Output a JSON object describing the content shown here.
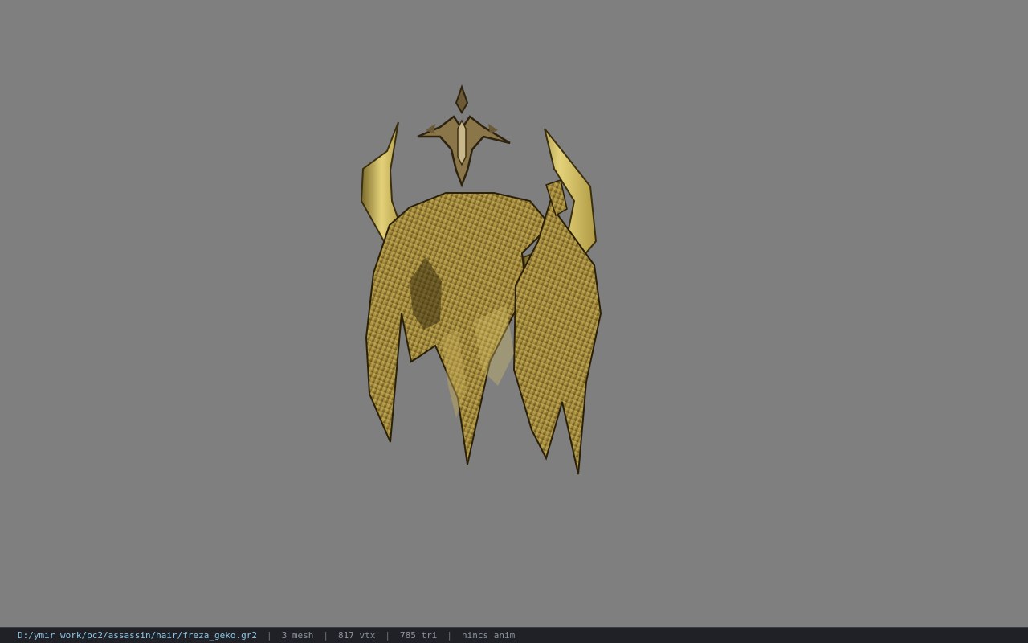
{
  "viewport": {
    "background": "#7f7f7f",
    "model_icon": "horned-hair-helmet-model"
  },
  "statusbar": {
    "file_path": "D:/ymir work/pc2/assassin/hair/freza_geko.gr2",
    "separator": "|",
    "mesh_count": "3 mesh",
    "vertex_count": "817 vtx",
    "triangle_count": "785 tri",
    "anim_status": "nincs anim"
  }
}
